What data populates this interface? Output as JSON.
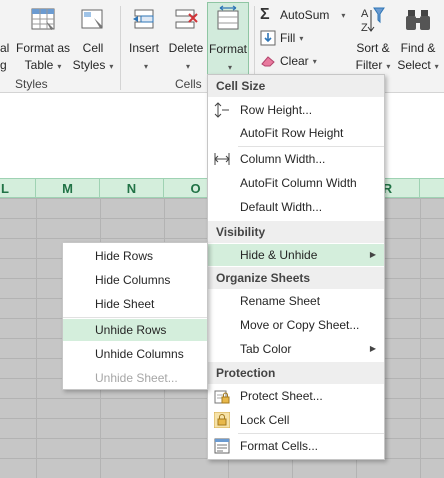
{
  "ribbon": {
    "buttons": {
      "conditional_partial": "al",
      "conditional_partial2": "g",
      "format_table_1": "Format as",
      "format_table_2": "Table",
      "cell_styles_1": "Cell",
      "cell_styles_2": "Styles",
      "insert": "Insert",
      "delete": "Delete",
      "format": "Format",
      "autosum": "AutoSum",
      "fill": "Fill",
      "clear": "Clear",
      "sort_filter_1": "Sort &",
      "sort_filter_2": "Filter",
      "find_select_1": "Find &",
      "find_select_2": "Select"
    },
    "groups": {
      "styles": "Styles",
      "cells": "Cells"
    }
  },
  "sheet": {
    "columns": [
      "L",
      "M",
      "N",
      "O",
      "R"
    ]
  },
  "format_menu": {
    "sections": {
      "cell_size": "Cell Size",
      "visibility": "Visibility",
      "organize": "Organize Sheets",
      "protection": "Protection"
    },
    "items": {
      "row_height": "Row Height...",
      "autofit_row": "AutoFit Row Height",
      "column_width": "Column Width...",
      "autofit_col": "AutoFit Column Width",
      "default_width": "Default Width...",
      "hide_unhide": "Hide & Unhide",
      "rename_sheet": "Rename Sheet",
      "move_copy": "Move or Copy Sheet...",
      "tab_color": "Tab Color",
      "protect_sheet": "Protect Sheet...",
      "lock_cell": "Lock Cell",
      "format_cells": "Format Cells..."
    }
  },
  "hide_submenu": {
    "items": {
      "hide_rows": "Hide Rows",
      "hide_columns": "Hide Columns",
      "hide_sheet": "Hide Sheet",
      "unhide_rows": "Unhide Rows",
      "unhide_columns": "Unhide Columns",
      "unhide_sheet": "Unhide Sheet..."
    }
  },
  "colors": {
    "accent_green": "#217346",
    "highlight": "#d4eedc",
    "grid_gray": "#c6c6c6"
  }
}
